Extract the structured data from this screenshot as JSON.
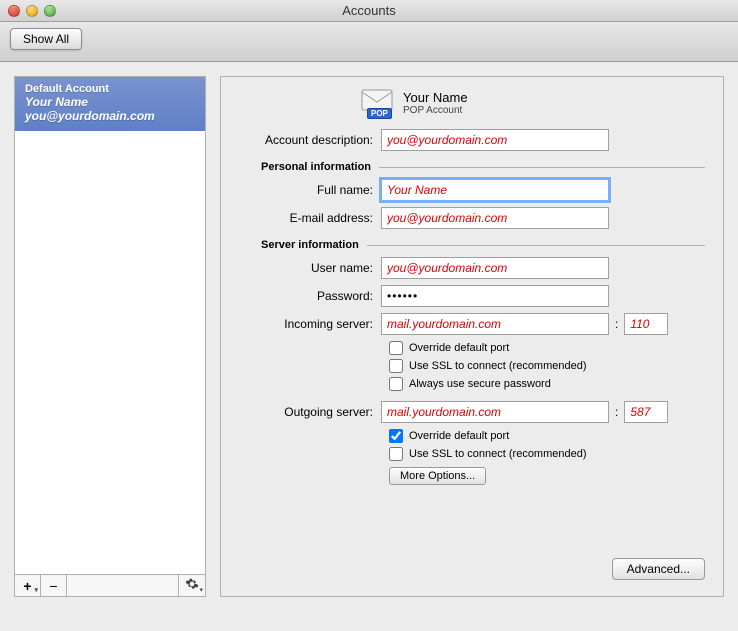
{
  "window": {
    "title": "Accounts"
  },
  "toolbar": {
    "show_all": "Show All"
  },
  "sidebar": {
    "account": {
      "heading": "Default Account",
      "name": "Your Name",
      "email": "you@yourdomain.com"
    },
    "footer": {
      "plus": "+",
      "minus": "–",
      "gear": "✻"
    }
  },
  "header": {
    "name": "Your Name",
    "type": "POP Account",
    "badge": "POP"
  },
  "labels": {
    "account_description": "Account description:",
    "personal_info": "Personal information",
    "full_name": "Full name:",
    "email": "E-mail address:",
    "server_info": "Server information",
    "user_name": "User name:",
    "password": "Password:",
    "incoming": "Incoming server:",
    "outgoing": "Outgoing server:",
    "override_port": "Override default port",
    "use_ssl": "Use SSL to connect (recommended)",
    "secure_pw": "Always use secure password",
    "more_options": "More Options...",
    "advanced": "Advanced...",
    "colon": ":"
  },
  "values": {
    "account_description": "you@yourdomain.com",
    "full_name": "Your Name",
    "email": "you@yourdomain.com",
    "user_name": "you@yourdomain.com",
    "password": "••••••",
    "incoming_server": "mail.yourdomain.com",
    "incoming_port": "110",
    "outgoing_server": "mail.yourdomain.com",
    "outgoing_port": "587"
  },
  "checks": {
    "in_override": false,
    "in_ssl": false,
    "in_secure": false,
    "out_override": true,
    "out_ssl": false
  }
}
